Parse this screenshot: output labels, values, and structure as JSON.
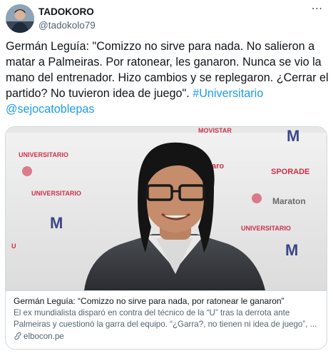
{
  "author": {
    "display_name": "TADOKORO",
    "handle": "@tadokolo79",
    "avatar_icon": "user-avatar"
  },
  "more_icon": "more-horizontal-icon",
  "tweet": {
    "text": "Germán Leguía: \"Comizzo no sirve para nada. No salieron a matar a Palmeiras. Por ratonear, les ganaron. Nunca se vio la mano del entrenador. Hizo cambios y se replegaron. ¿Cerrar el partido? No tuvieron idea de juego\". ",
    "hashtag": "#Universitario",
    "mention": "@sejocatoblepas"
  },
  "card": {
    "title": "Germán Leguía: “Comizzo no sirve para nada, por ratonear le ganaron”",
    "description": "El ex mundialista disparó en contra del técnico de la “U” tras la derrota ante Palmeiras y cuestionó la garra del equipo. “¿Garra?, no tienen ni idea de juego”, ...",
    "domain": "elbocon.pe",
    "link_icon": "link-icon"
  },
  "colors": {
    "link": "#1d9bf0",
    "text": "#0f1419",
    "muted": "#536471",
    "border": "#cfd9de"
  }
}
